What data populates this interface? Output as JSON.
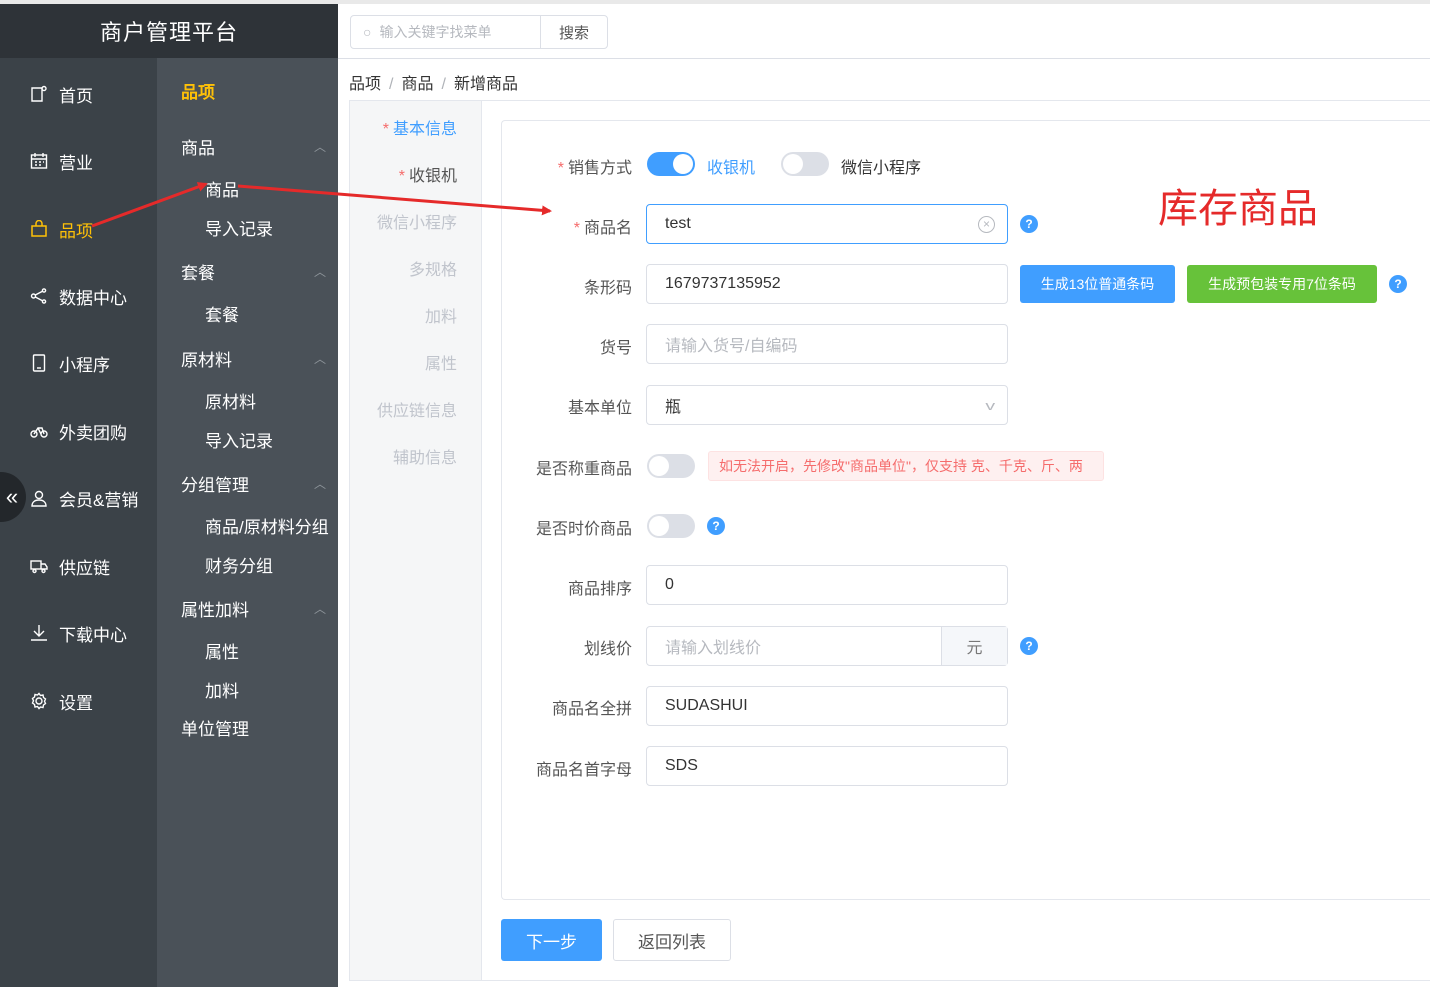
{
  "app": {
    "title": "商户管理平台"
  },
  "sidebar": {
    "items": [
      {
        "label": "首页",
        "icon": "home-icon"
      },
      {
        "label": "营业",
        "icon": "calendar-icon"
      },
      {
        "label": "品项",
        "icon": "bag-icon",
        "active": true
      },
      {
        "label": "数据中心",
        "icon": "share-icon"
      },
      {
        "label": "小程序",
        "icon": "phone-icon"
      },
      {
        "label": "外卖团购",
        "icon": "bike-icon"
      },
      {
        "label": "会员&营销",
        "icon": "user-icon"
      },
      {
        "label": "供应链",
        "icon": "truck-icon"
      },
      {
        "label": "下载中心",
        "icon": "download-icon"
      },
      {
        "label": "设置",
        "icon": "gear-icon"
      }
    ],
    "collapse_glyph": "«"
  },
  "subnav": {
    "heading": "品项",
    "groups": [
      {
        "label": "商品",
        "items": [
          "商品",
          "导入记录"
        ]
      },
      {
        "label": "套餐",
        "items": [
          "套餐"
        ]
      },
      {
        "label": "原材料",
        "items": [
          "原材料",
          "导入记录"
        ]
      },
      {
        "label": "分组管理",
        "items": [
          "商品/原材料分组",
          "财务分组"
        ]
      },
      {
        "label": "属性加料",
        "items": [
          "属性",
          "加料"
        ]
      }
    ],
    "single": "单位管理"
  },
  "search": {
    "placeholder": "输入关键字找菜单",
    "button": "搜索"
  },
  "breadcrumb": [
    "品项",
    "商品",
    "新增商品"
  ],
  "tabs": [
    "基本信息",
    "收银机",
    "微信小程序",
    "多规格",
    "加料",
    "属性",
    "供应链信息",
    "辅助信息"
  ],
  "form": {
    "sale_mode": {
      "label": "销售方式",
      "options": [
        {
          "label": "收银机",
          "on": true
        },
        {
          "label": "微信小程序",
          "on": false
        }
      ]
    },
    "name": {
      "label": "商品名",
      "value": "test"
    },
    "barcode": {
      "label": "条形码",
      "value": "1679737135952",
      "btn13": "生成13位普通条码",
      "btn7": "生成预包装专用7位条码"
    },
    "item_no": {
      "label": "货号",
      "placeholder": "请输入货号/自编码"
    },
    "unit": {
      "label": "基本单位",
      "value": "瓶"
    },
    "weighed": {
      "label": "是否称重商品",
      "notice": "如无法开启，先修改\"商品单位\"，仅支持 克、千克、斤、两"
    },
    "timed_price": {
      "label": "是否时价商品"
    },
    "sort": {
      "label": "商品排序",
      "value": "0"
    },
    "strike_price": {
      "label": "划线价",
      "placeholder": "请输入划线价",
      "suffix": "元"
    },
    "pinyin_full": {
      "label": "商品名全拼",
      "value": "SUDASHUI"
    },
    "pinyin_initials": {
      "label": "商品名首字母",
      "value": "SDS"
    }
  },
  "footer": {
    "next": "下一步",
    "back": "返回列表"
  },
  "annotation": {
    "text": "库存商品",
    "color": "#e52a2a"
  },
  "colors": {
    "accent": "#409eff",
    "active_nav": "#ffc107",
    "green": "#67c23a",
    "required": "#f56c6c"
  }
}
